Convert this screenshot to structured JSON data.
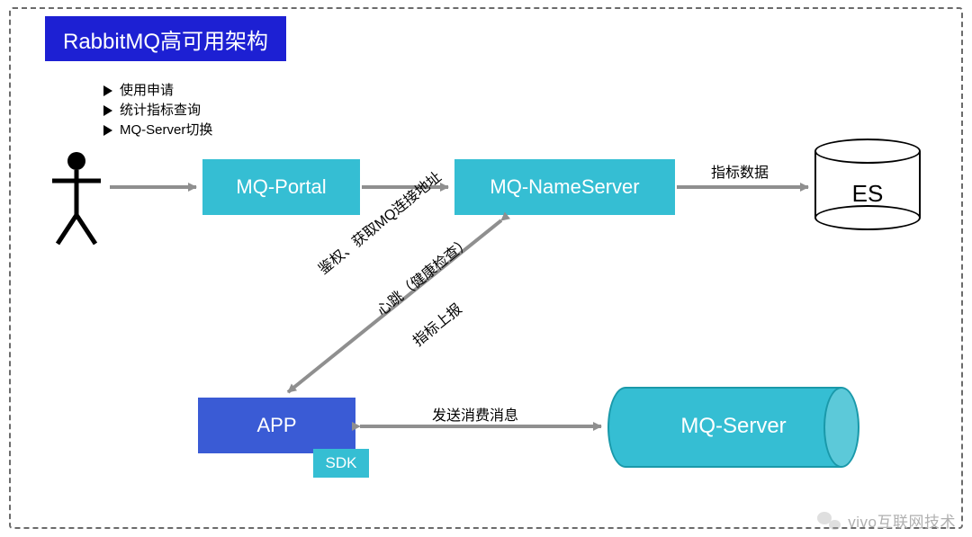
{
  "title": "RabbitMQ高可用架构",
  "bullets": [
    "使用申请",
    "统计指标查询",
    "MQ-Server切换"
  ],
  "nodes": {
    "portal": "MQ-Portal",
    "nameserver": "MQ-NameServer",
    "es": "ES",
    "app": "APP",
    "sdk": "SDK",
    "mqserver": "MQ-Server"
  },
  "edges": {
    "ns_to_es": "指标数据",
    "ns_app_upper": "鉴权、获取MQ连接地址",
    "ns_app_mid": "心跳（健康检查）",
    "ns_app_lower": "指标上报",
    "app_to_mqserver": "发送消费消息"
  },
  "watermark": "vivo互联网技术"
}
